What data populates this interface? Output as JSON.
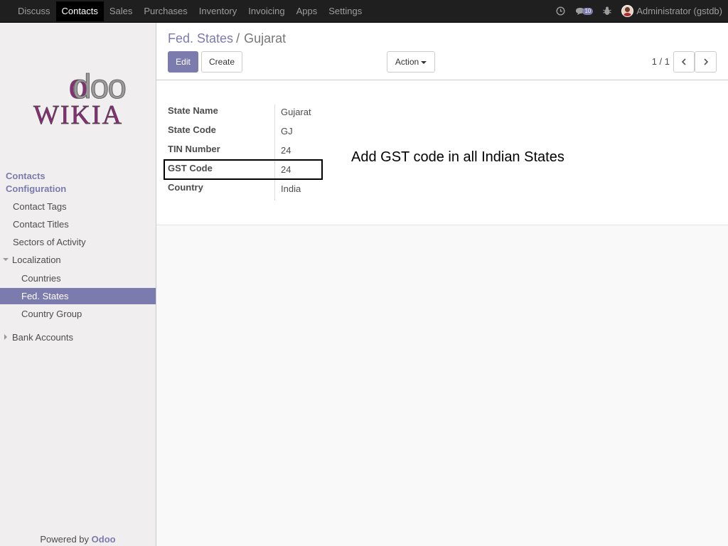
{
  "topnav": {
    "items": [
      {
        "label": "Discuss",
        "active": false
      },
      {
        "label": "Contacts",
        "active": true
      },
      {
        "label": "Sales",
        "active": false
      },
      {
        "label": "Purchases",
        "active": false
      },
      {
        "label": "Inventory",
        "active": false
      },
      {
        "label": "Invoicing",
        "active": false
      },
      {
        "label": "Apps",
        "active": false
      },
      {
        "label": "Settings",
        "active": false
      }
    ],
    "messages_count": "10",
    "user_label": "Administrator (gstdb)"
  },
  "sidebar": {
    "logo_text_top": "odoo",
    "logo_text_bottom": "WIKIA",
    "section_contacts": "Contacts",
    "section_configuration": "Configuration",
    "items": {
      "contact_tags": "Contact Tags",
      "contact_titles": "Contact Titles",
      "sectors": "Sectors of Activity",
      "localization": "Localization",
      "countries": "Countries",
      "fed_states": "Fed. States",
      "country_group": "Country Group",
      "bank_accounts": "Bank Accounts"
    },
    "powered_by": "Powered by",
    "powered_brand": "Odoo"
  },
  "control_panel": {
    "breadcrumb_parent": "Fed. States",
    "breadcrumb_separator": "/",
    "breadcrumb_current": "Gujarat",
    "edit_label": "Edit",
    "create_label": "Create",
    "action_label": "Action",
    "pager": "1 / 1"
  },
  "form": {
    "fields": [
      {
        "label": "State Name",
        "value": "Gujarat"
      },
      {
        "label": "State Code",
        "value": "GJ"
      },
      {
        "label": "TIN Number",
        "value": "24"
      },
      {
        "label": "GST Code",
        "value": "24"
      },
      {
        "label": "Country",
        "value": "India"
      }
    ]
  },
  "annotation": "Add GST code in all Indian States",
  "colors": {
    "brand": "#7c7bad",
    "navbar": "#1f1f1f",
    "sidebar_bg": "#f0eeee",
    "logo_magenta": "#8f2a7a"
  }
}
